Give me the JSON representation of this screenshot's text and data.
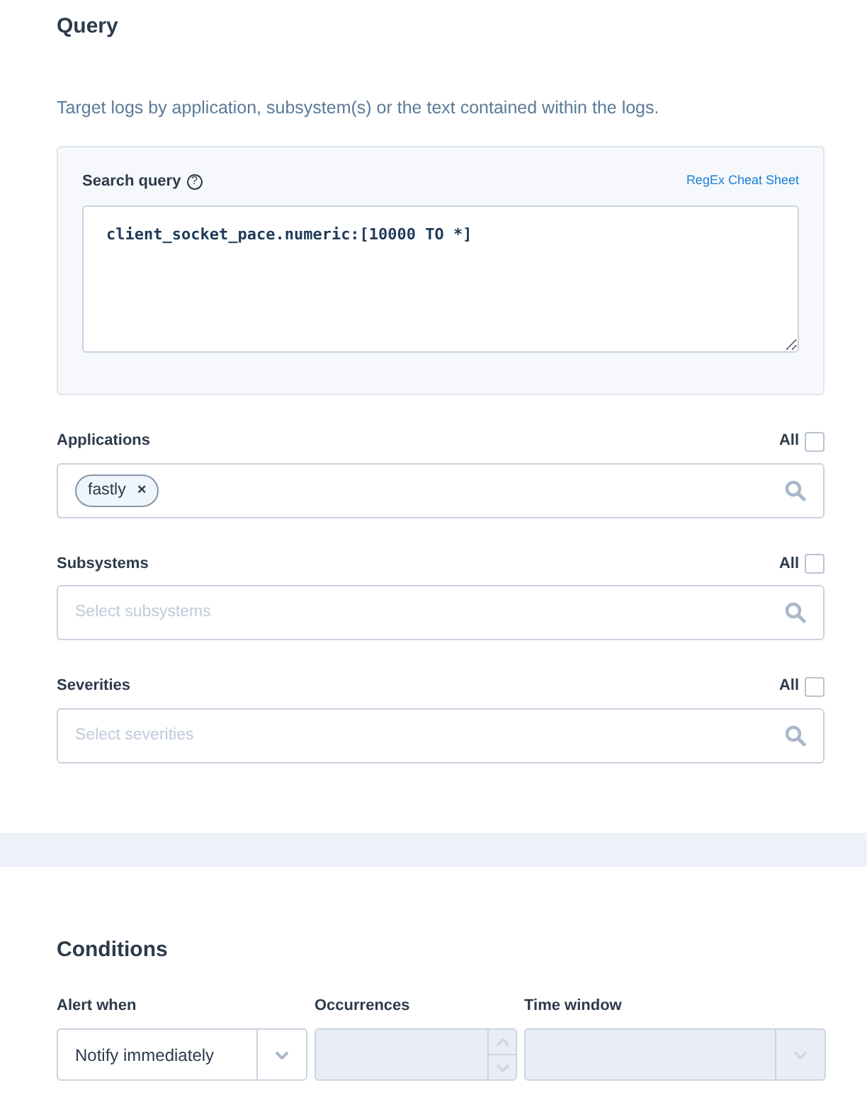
{
  "query": {
    "title": "Query",
    "description": "Target logs by application, subsystem(s) or the text contained within the logs.",
    "search_query": {
      "label": "Search query",
      "help": "?",
      "link": "RegEx Cheat Sheet",
      "value": "client_socket_pace.numeric:[10000 TO *]"
    },
    "filters": [
      {
        "label": "Applications",
        "all_label": "All",
        "all_checked": false,
        "tags": [
          {
            "label": "fastly",
            "remove": "×"
          }
        ]
      },
      {
        "label": "Subsystems",
        "all_label": "All",
        "all_checked": false,
        "placeholder": "Select subsystems"
      },
      {
        "label": "Severities",
        "all_label": "All",
        "all_checked": false,
        "placeholder": "Select severities"
      }
    ]
  },
  "conditions": {
    "title": "Conditions",
    "fields": [
      {
        "kind": "select",
        "label": "Alert when",
        "value": "Notify immediately",
        "disabled": false
      },
      {
        "kind": "number",
        "label": "Occurrences",
        "disabled": true
      },
      {
        "kind": "select",
        "label": "Time window",
        "disabled": true
      }
    ]
  }
}
